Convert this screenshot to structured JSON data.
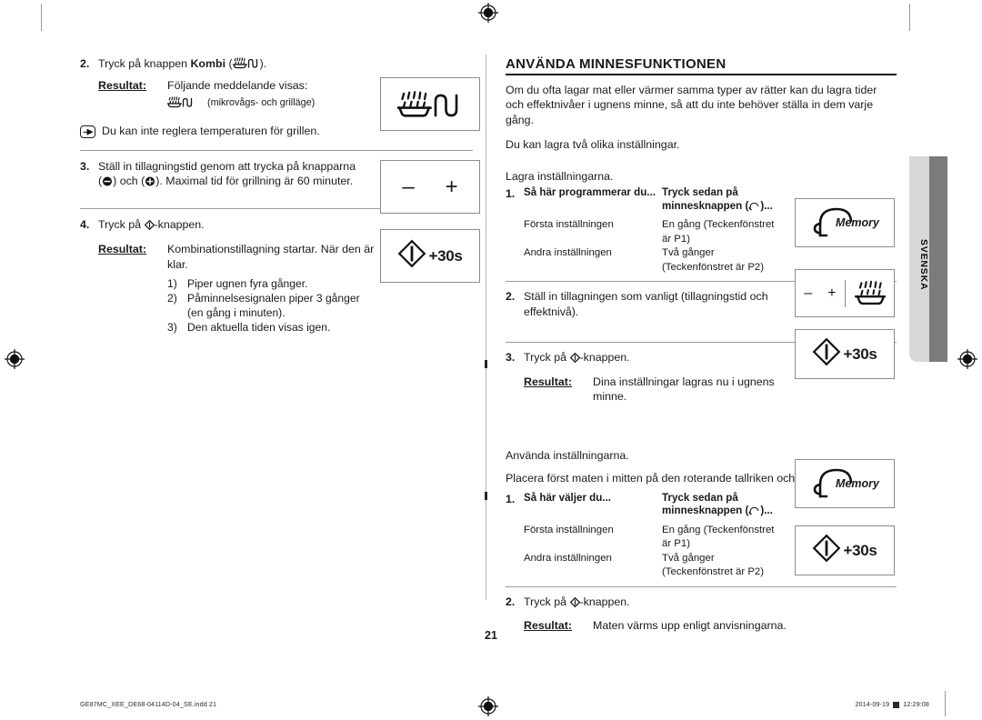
{
  "page": {
    "number": "21",
    "language_tab": "SVENSKA"
  },
  "left_column": {
    "step2": {
      "num": "2.",
      "text_before": "Tryck på knappen",
      "text_bold": "Kombi",
      "text_after": ").",
      "paren_open": "(",
      "result_label": "Resultat:",
      "result_text": "Följande meddelande visas:",
      "mode_caption": "(mikrovågs- och grilläge)"
    },
    "note": {
      "icon": "pointing-hand-icon",
      "text": "Du kan inte reglera temperaturen för grillen."
    },
    "step3": {
      "num": "3.",
      "line1": "Ställ in tillagningstid genom att trycka på knapparna",
      "line2_a": "(",
      "line2_minus": "—",
      "line2_b": ") och (",
      "line2_plus": "+",
      "line2_c": "). Maximal tid för grillning är 60 minuter."
    },
    "step4": {
      "num": "4.",
      "text_before": "Tryck på",
      "text_after": "-knappen.",
      "result_label": "Resultat:",
      "result_text": "Kombinationstillagning startar. När den är klar.",
      "sub_items": [
        {
          "marker": "1)",
          "text": "Piper ugnen fyra gånger."
        },
        {
          "marker": "2)",
          "text": "Påminnelsesignalen piper 3 gånger (en gång i minuten)."
        },
        {
          "marker": "3)",
          "text": "Den aktuella tiden visas igen."
        }
      ]
    },
    "icon_boxes": {
      "kombi": "kombi-icon",
      "minus_plus_minus": "–",
      "minus_plus_plus": "+",
      "start_label": "+30s"
    }
  },
  "right_column": {
    "heading": "ANVÄNDA MINNESFUNKTIONEN",
    "intro_1": "Om du ofta lagar mat eller värmer samma typer av rätter kan du lagra tider och effektnivåer i ugnens minne, så att du inte behöver ställa in dem varje gång.",
    "intro_2": "Du kan lagra två olika inställningar.",
    "section_store": {
      "lead": "Lagra inställningarna.",
      "step1": {
        "num": "1.",
        "col1_header": "Så här programmerar du...",
        "col2_header_line1": "Tryck sedan på",
        "col2_header_line2_a": "minnesknappen (",
        "col2_header_line2_b": ")...",
        "rows": [
          {
            "setting": "Första inställningen",
            "action": "En gång (Teckenfönstret är P1)"
          },
          {
            "setting": "Andra inställningen",
            "action": "Två gånger (Teckenfönstret är P2)"
          }
        ],
        "icon_label": "Memory"
      },
      "step2": {
        "num": "2.",
        "text": "Ställ in tillagningen som vanligt (tillagningstid och effektnivå).",
        "icon_minus": "–",
        "icon_plus": "+",
        "icon_kombi": "kombi-icon"
      },
      "step3": {
        "num": "3.",
        "text_before": "Tryck på",
        "text_after": "-knappen.",
        "result_label": "Resultat:",
        "result_text": "Dina inställningar lagras nu i ugnens minne.",
        "icon_label": "+30s"
      }
    },
    "section_use": {
      "lead": "Använda inställningarna.",
      "intro": "Placera först maten i mitten på den roterande tallriken och stäng dörren.",
      "step1": {
        "num": "1.",
        "col1_header": "Så här väljer du...",
        "col2_header_line1": "Tryck sedan på",
        "col2_header_line2_a": "minnesknappen (",
        "col2_header_line2_b": ")...",
        "rows": [
          {
            "setting": "Första inställningen",
            "action": "En gång (Teckenfönstret är P1)"
          },
          {
            "setting": "Andra inställningen",
            "action": "Två gånger (Teckenfönstret är P2)"
          }
        ],
        "icon_label": "Memory"
      },
      "step2": {
        "num": "2.",
        "text_before": "Tryck på",
        "text_after": "-knappen.",
        "result_label": "Resultat:",
        "result_text": "Maten värms upp enligt anvisningarna.",
        "icon_label": "+30s"
      }
    }
  },
  "footer": {
    "left": "GE87MC_XEE_DE68-04114D-04_SE.indd   21",
    "date": "2014-09-19",
    "time": "12:29:08"
  }
}
